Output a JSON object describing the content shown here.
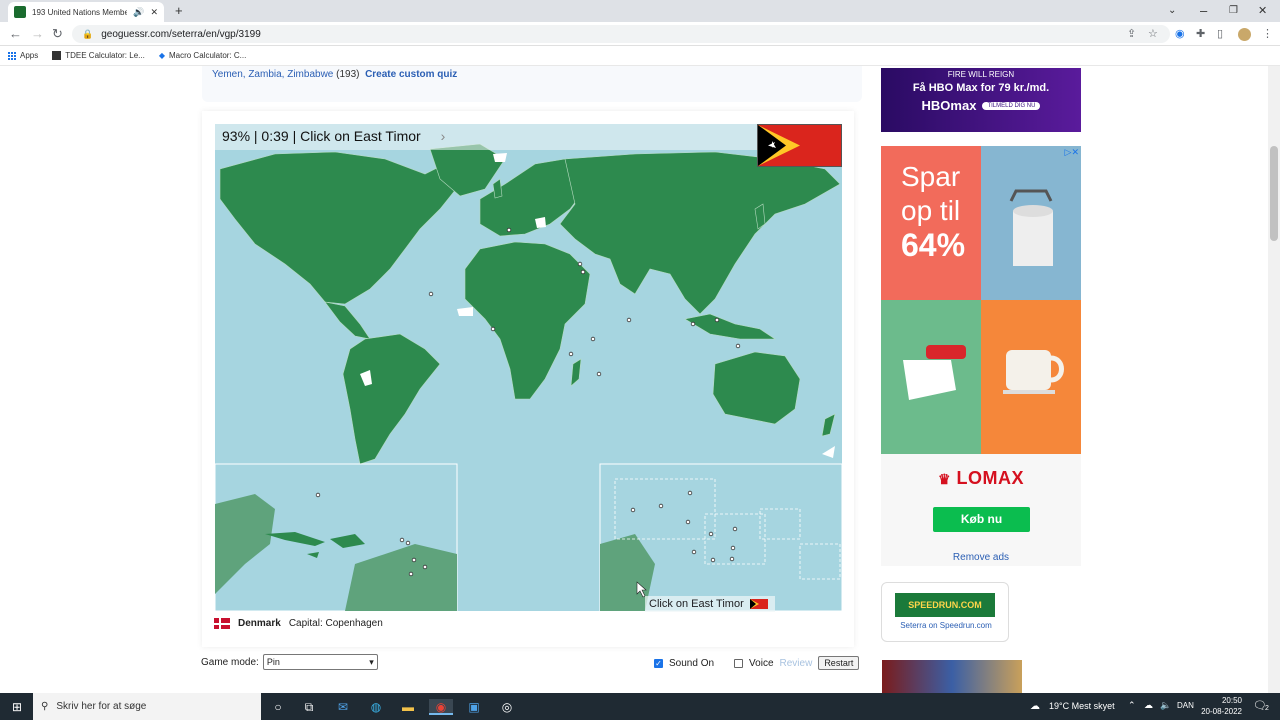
{
  "browser": {
    "tab_title": "193 United Nations Member",
    "url": "geoguessr.com/seterra/en/vgp/3199",
    "bookmarks": [
      "Apps",
      "TDEE Calculator: Le...",
      "Macro Calculator: C..."
    ]
  },
  "lead": {
    "countries_text": "Yemen, Zambia, Zimbabwe",
    "count": "(193)",
    "custom_quiz": "Create custom quiz"
  },
  "game": {
    "status": "93% | 0:39 | Click on East Timor",
    "prompt": "Click on East Timor",
    "last_country": "Denmark",
    "last_capital": "Capital: Copenhagen",
    "flag_colors": {
      "red": "#da251d",
      "yellow": "#ffc726",
      "black": "#000000"
    },
    "land_color": "#2d8a4e",
    "sea_color": "#a6d5e0"
  },
  "controls": {
    "game_mode_label": "Game mode:",
    "game_mode_value": "Pin",
    "sound": "Sound On",
    "voice": "Voice",
    "review": "Review",
    "restart": "Restart"
  },
  "ads": {
    "hbo_line1": "FIRE WILL REIGN",
    "hbo_line2": "Få HBO Max for 79 kr./md.",
    "hbo_logo": "HBOmax",
    "hbo_cta": "TILMELD DIG NU",
    "spar1": "Spar",
    "spar2": "op til",
    "spar3": "64%",
    "lomax": "LOMAX",
    "buy": "Køb nu",
    "remove": "Remove ads",
    "speedrun_logo": "SPEEDRUN.COM",
    "speedrun_text": "Seterra on Speedrun.com"
  },
  "taskbar": {
    "search": "Skriv her for at søge",
    "weather": "19°C  Mest skyet",
    "lang": "DAN",
    "time": "20:50",
    "date": "20-08-2022",
    "notif": "2"
  }
}
